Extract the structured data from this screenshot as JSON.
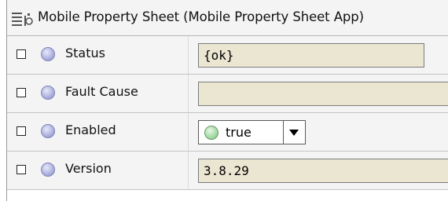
{
  "sheet": {
    "title": "Mobile Property Sheet  (Mobile Property Sheet App)",
    "title_icon": "property-sheet-icon"
  },
  "properties": [
    {
      "label": "Status",
      "value": "{ok}",
      "kind": "text",
      "status_color": "#b9bde6"
    },
    {
      "label": "Fault Cause",
      "value": "",
      "kind": "text",
      "status_color": "#b9bde6"
    },
    {
      "label": "Enabled",
      "value": "true",
      "kind": "dropdown",
      "status_color": "#b9bde6",
      "value_dot_color": "#a8e0a8"
    },
    {
      "label": "Version",
      "value": "3.8.29",
      "kind": "text",
      "status_color": "#b9bde6"
    }
  ],
  "colors": {
    "field_background": "#ebe6d2",
    "row_background": "#f4f4f4",
    "status_dot": "#b9bde6",
    "true_dot": "#a8e0a8"
  }
}
